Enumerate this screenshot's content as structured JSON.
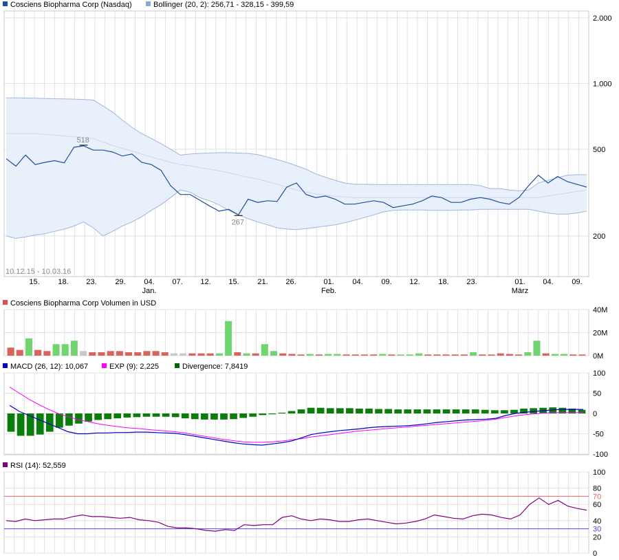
{
  "legends": {
    "price": {
      "text": "Cosciens Biopharma Corp (Nasdaq)",
      "color": "#1f4e9c"
    },
    "bollinger": {
      "text": "Bollinger (20, 2): 256,71 - 328,15 - 399,59",
      "color": "#8aa7d6"
    },
    "volume": {
      "text": "Cosciens Biopharma Corp Volumen in USD",
      "color": "#d9534f"
    },
    "macd": {
      "text": "MACD (26, 12): 10,067",
      "color": "#0000cc"
    },
    "exp": {
      "text": "EXP (9): 2,225",
      "color": "#ff00ff"
    },
    "divergence": {
      "text": "Divergence: 7,8419",
      "color": "#006600"
    },
    "rsi": {
      "text": "RSI (14): 52,559",
      "color": "#800080"
    }
  },
  "date_range": "10.12.15 - 10.03.16",
  "x_labels": [
    "15.",
    "18.",
    "23.",
    "29.",
    "04.",
    "07.",
    "12.",
    "15.",
    "21.",
    "26.",
    "01.",
    "04.",
    "09.",
    "12.",
    "18.",
    "23.",
    "01.",
    "04.",
    "09."
  ],
  "x_label_months": [
    {
      "after": "04.",
      "text": "Jan.",
      "index": 4
    },
    {
      "text": "Feb.",
      "index": 10
    },
    {
      "text": "März",
      "index": 16
    }
  ],
  "chart_data": [
    {
      "type": "line",
      "name": "price",
      "yscale": "log",
      "ylim": [
        150,
        2000
      ],
      "ticks": [
        "2.000",
        "1.000",
        "500",
        "200"
      ],
      "tick_values": [
        2000,
        1000,
        500,
        200
      ],
      "price": [
        452,
        418,
        470,
        425,
        435,
        443,
        433,
        510,
        518,
        495,
        495,
        485,
        465,
        475,
        435,
        425,
        400,
        340,
        310,
        310,
        292,
        275,
        260,
        265,
        250,
        295,
        285,
        290,
        288,
        335,
        350,
        310,
        300,
        305,
        295,
        280,
        280,
        285,
        290,
        285,
        270,
        275,
        280,
        290,
        305,
        300,
        285,
        285,
        295,
        300,
        295,
        285,
        280,
        300,
        340,
        380,
        350,
        375,
        355,
        345,
        335
      ],
      "boll_upper": [
        860,
        860,
        858,
        856,
        854,
        852,
        850,
        848,
        845,
        840,
        790,
        740,
        680,
        630,
        590,
        560,
        530,
        500,
        470,
        475,
        478,
        480,
        482,
        482,
        480,
        478,
        472,
        460,
        448,
        435,
        420,
        405,
        385,
        372,
        360,
        350,
        345,
        345,
        344,
        344,
        344,
        344,
        344,
        344,
        344,
        344,
        344,
        344,
        344,
        340,
        330,
        330,
        325,
        322,
        325,
        350,
        360,
        370,
        380,
        382,
        382
      ],
      "boll_mid": [
        590,
        590,
        590,
        590,
        585,
        580,
        575,
        570,
        565,
        560,
        540,
        520,
        505,
        490,
        475,
        460,
        448,
        435,
        425,
        420,
        412,
        405,
        398,
        390,
        380,
        372,
        365,
        355,
        345,
        335,
        325,
        318,
        312,
        308,
        304,
        302,
        300,
        300,
        300,
        300,
        300,
        300,
        300,
        300,
        300,
        300,
        300,
        300,
        300,
        300,
        300,
        300,
        300,
        300,
        300,
        300,
        305,
        310,
        315,
        320,
        325
      ],
      "boll_lower": [
        200,
        195,
        198,
        202,
        205,
        210,
        215,
        222,
        232,
        218,
        200,
        210,
        222,
        232,
        245,
        262,
        278,
        300,
        325,
        318,
        300,
        290,
        278,
        262,
        250,
        240,
        232,
        225,
        218,
        215,
        214,
        216,
        219,
        222,
        225,
        230,
        236,
        243,
        250,
        258,
        262,
        263,
        263,
        263,
        262,
        262,
        262,
        263,
        263,
        265,
        265,
        265,
        265,
        265,
        265,
        260,
        255,
        252,
        252,
        255,
        260
      ],
      "annotations": [
        {
          "label": "518",
          "index": 8
        },
        {
          "label": "267",
          "index": 24
        }
      ]
    },
    {
      "type": "bar",
      "name": "volume",
      "ylim": [
        0,
        40
      ],
      "ticks": [
        "40M",
        "20M",
        "0M"
      ],
      "tick_values": [
        40,
        20,
        0
      ],
      "values": [
        7,
        5,
        15,
        5,
        4,
        10,
        10,
        13,
        4,
        3,
        3,
        4,
        4,
        3,
        3,
        4,
        4,
        3,
        2,
        2,
        2,
        2,
        2,
        2,
        30,
        3,
        2,
        2,
        10,
        4,
        2,
        1.5,
        1,
        1.5,
        1,
        1.5,
        1.5,
        1,
        1,
        1,
        1,
        1.5,
        1,
        1,
        1,
        2,
        1,
        1,
        1,
        1,
        1,
        3,
        1,
        1,
        2,
        1.5,
        1,
        3,
        13,
        2,
        1.5,
        1.5,
        1,
        1
      ],
      "up": [
        false,
        false,
        true,
        false,
        false,
        true,
        true,
        true,
        false,
        false,
        false,
        false,
        false,
        false,
        false,
        false,
        false,
        false,
        false,
        false,
        false,
        false,
        false,
        true,
        true,
        false,
        true,
        false,
        true,
        true,
        false,
        false,
        false,
        true,
        false,
        true,
        true,
        false,
        false,
        false,
        false,
        true,
        false,
        true,
        true,
        true,
        false,
        false,
        false,
        false,
        false,
        true,
        false,
        false,
        false,
        false,
        false,
        true,
        true,
        false,
        true,
        true,
        false,
        false
      ],
      "neutral": [
        false,
        false,
        false,
        false,
        false,
        false,
        false,
        false,
        true,
        false,
        false,
        false,
        false,
        false,
        false,
        false,
        false,
        false,
        true,
        true,
        false,
        false,
        false,
        false,
        false,
        false,
        false,
        false,
        false,
        false,
        false,
        false,
        false,
        false,
        false,
        false,
        false,
        false,
        false,
        false,
        false,
        false,
        false,
        false,
        false,
        false,
        false,
        false,
        false,
        false,
        false,
        false,
        false,
        false,
        false,
        false,
        false,
        false,
        false,
        false,
        false,
        false,
        false,
        false
      ]
    },
    {
      "type": "bar",
      "name": "macd",
      "ylim": [
        -100,
        100
      ],
      "ticks": [
        "100",
        "50",
        "0",
        "-50",
        "-100"
      ],
      "tick_values": [
        100,
        50,
        0,
        -50,
        -100
      ],
      "macd": [
        20,
        5,
        -5,
        -15,
        -25,
        -35,
        -45,
        -50,
        -50,
        -48,
        -48,
        -47,
        -47,
        -46,
        -46,
        -47,
        -48,
        -49,
        -52,
        -56,
        -60,
        -64,
        -68,
        -72,
        -75,
        -77,
        -78,
        -75,
        -72,
        -68,
        -60,
        -52,
        -48,
        -45,
        -42,
        -40,
        -38,
        -35,
        -33,
        -32,
        -31,
        -30,
        -28,
        -25,
        -22,
        -20,
        -18,
        -16,
        -15,
        -14,
        -12,
        -5,
        0,
        3,
        5,
        7,
        9,
        10,
        10,
        10
      ],
      "exp": [
        65,
        50,
        35,
        22,
        10,
        0,
        -8,
        -15,
        -20,
        -25,
        -29,
        -32,
        -35,
        -37,
        -39,
        -41,
        -43,
        -45,
        -48,
        -52,
        -56,
        -60,
        -64,
        -67,
        -70,
        -71,
        -71,
        -70,
        -68,
        -65,
        -62,
        -58,
        -55,
        -52,
        -49,
        -46,
        -43,
        -41,
        -39,
        -37,
        -35,
        -33,
        -31,
        -29,
        -27,
        -25,
        -23,
        -21,
        -19,
        -17,
        -14,
        -10,
        -6,
        -3,
        -1,
        1,
        2,
        2,
        2,
        2
      ],
      "divergence": [
        -45,
        -55,
        -55,
        -52,
        -45,
        -35,
        -30,
        -25,
        -20,
        -16,
        -14,
        -12,
        -10,
        -9,
        -8,
        -8,
        -8,
        -9,
        -12,
        -14,
        -15,
        -15,
        -15,
        -14,
        -11,
        -8,
        -4,
        -2,
        2,
        6,
        10,
        14,
        14,
        13,
        13,
        13,
        12,
        12,
        11,
        11,
        10,
        10,
        10,
        10,
        10,
        10,
        10,
        10,
        10,
        9,
        8,
        8,
        9,
        12,
        13,
        14,
        15,
        14,
        12,
        9
      ]
    },
    {
      "type": "line",
      "name": "rsi",
      "ylim": [
        0,
        100
      ],
      "ticks": [
        "100",
        "80",
        "60",
        "40",
        "20",
        "0"
      ],
      "tick_values": [
        100,
        80,
        60,
        40,
        20,
        0
      ],
      "ref_lines": [
        {
          "label": "70",
          "value": 70,
          "color": "#e06666"
        },
        {
          "label": "30",
          "value": 30,
          "color": "#4a4ae0"
        }
      ],
      "values": [
        40,
        39,
        42,
        40,
        41,
        42,
        42,
        45,
        47,
        45,
        45,
        44,
        43,
        44,
        41,
        40,
        38,
        33,
        31,
        31,
        30,
        28,
        27,
        29,
        28,
        35,
        34,
        35,
        35,
        44,
        46,
        42,
        40,
        42,
        41,
        39,
        39,
        41,
        42,
        40,
        38,
        36,
        37,
        39,
        42,
        47,
        45,
        43,
        42,
        46,
        48,
        47,
        44,
        42,
        47,
        60,
        68,
        60,
        65,
        58,
        55,
        53
      ]
    }
  ]
}
